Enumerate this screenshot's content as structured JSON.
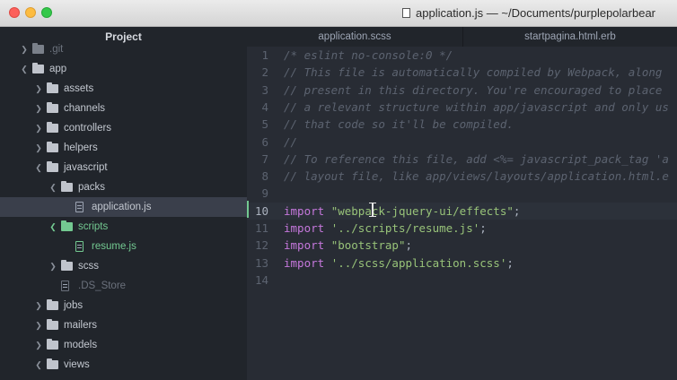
{
  "window": {
    "title": "application.js — ~/Documents/purplepolarbear"
  },
  "sidebar": {
    "title": "Project",
    "items": [
      {
        "label": ".git"
      },
      {
        "label": "app"
      },
      {
        "label": "assets"
      },
      {
        "label": "channels"
      },
      {
        "label": "controllers"
      },
      {
        "label": "helpers"
      },
      {
        "label": "javascript"
      },
      {
        "label": "packs"
      },
      {
        "label": "application.js"
      },
      {
        "label": "scripts"
      },
      {
        "label": "resume.js"
      },
      {
        "label": "scss"
      },
      {
        "label": ".DS_Store"
      },
      {
        "label": "jobs"
      },
      {
        "label": "mailers"
      },
      {
        "label": "models"
      },
      {
        "label": "views"
      }
    ]
  },
  "tabs": [
    {
      "label": "application.scss"
    },
    {
      "label": "startpagina.html.erb"
    }
  ],
  "editor": {
    "active_line": 10,
    "lines": [
      {
        "n": "1",
        "code": "/* eslint no-console:0 */"
      },
      {
        "n": "2",
        "code": "// This file is automatically compiled by Webpack, along"
      },
      {
        "n": "3",
        "code": "// present in this directory. You're encouraged to place"
      },
      {
        "n": "4",
        "code": "// a relevant structure within app/javascript and only us"
      },
      {
        "n": "5",
        "code": "// that code so it'll be compiled."
      },
      {
        "n": "6",
        "code": "//"
      },
      {
        "n": "7",
        "code": "// To reference this file, add <%= javascript_pack_tag 'a"
      },
      {
        "n": "8",
        "code": "// layout file, like app/views/layouts/application.html.e"
      },
      {
        "n": "9",
        "code": ""
      },
      {
        "n": "10",
        "kw": "import",
        "str": "\"webpack-jquery-ui/effects\"",
        "end": ";"
      },
      {
        "n": "11",
        "kw": "import",
        "str": "'../scripts/resume.js'",
        "end": ";"
      },
      {
        "n": "12",
        "kw": "import",
        "str": "\"bootstrap\"",
        "end": ";"
      },
      {
        "n": "13",
        "kw": "import",
        "str": "'../scss/application.scss'",
        "end": ";"
      },
      {
        "n": "14",
        "code": ""
      }
    ]
  }
}
